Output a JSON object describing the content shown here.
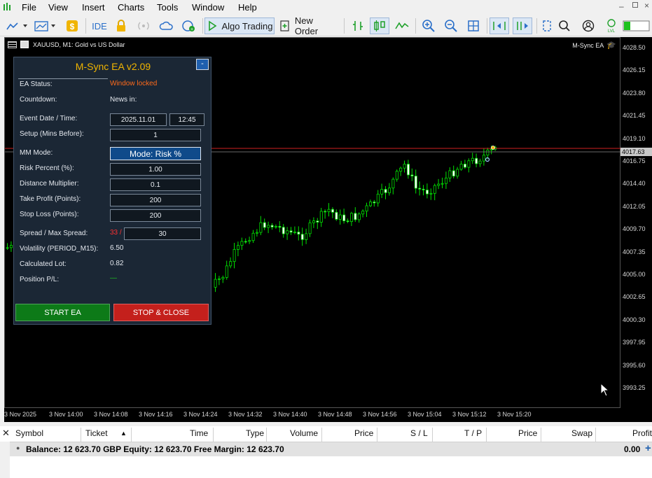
{
  "menu": {
    "items": [
      "File",
      "View",
      "Insert",
      "Charts",
      "Tools",
      "Window",
      "Help"
    ]
  },
  "toolbar": {
    "ide_label": "IDE",
    "algo_trading_label": "Algo Trading",
    "new_order_label": "New Order"
  },
  "chart": {
    "symbol_label": "XAUUSD, M1:  Gold vs US Dollar",
    "ea_label": "M-Sync EA",
    "current_price": "4017.63",
    "price_ticks": [
      "4028.50",
      "4026.15",
      "4023.80",
      "4021.45",
      "4019.10",
      "4016.75",
      "4014.40",
      "4012.05",
      "4009.70",
      "4007.35",
      "4005.00",
      "4002.65",
      "4000.30",
      "3997.95",
      "3995.60",
      "3993.25"
    ],
    "time_ticks": [
      "3 Nov 2025",
      "3 Nov 14:00",
      "3 Nov 14:08",
      "3 Nov 14:16",
      "3 Nov 14:24",
      "3 Nov 14:32",
      "3 Nov 14:40",
      "3 Nov 14:48",
      "3 Nov 14:56",
      "3 Nov 15:04",
      "3 Nov 15:12",
      "3 Nov 15:20"
    ],
    "colors": {
      "bull": "#00e000",
      "bear": "#ffffff",
      "bid_line": "#d02020",
      "background": "#000000"
    }
  },
  "panel": {
    "title": "M-Sync EA v2.09",
    "minimize": "-",
    "ea_status_label": "EA Status:",
    "ea_status_value": "Window locked",
    "countdown_label": "Countdown:",
    "countdown_value": "News in:",
    "event_label": "Event Date / Time:",
    "event_date": "2025.11.01",
    "event_time": "12:45",
    "setup_label": "Setup (Mins Before):",
    "setup_value": "1",
    "mm_label": "MM Mode:",
    "mm_value": "Mode: Risk %",
    "risk_label": "Risk Percent (%):",
    "risk_value": "1.00",
    "distance_label": "Distance Multiplier:",
    "distance_value": "0.1",
    "tp_label": "Take Profit (Points):",
    "tp_value": "200",
    "sl_label": "Stop Loss (Points):",
    "sl_value": "200",
    "spread_label": "Spread / Max Spread:",
    "spread_current": "33 /",
    "spread_max": "30",
    "volatility_label": "Volatility (PERIOD_M15):",
    "volatility_value": "6.50",
    "lot_label": "Calculated Lot:",
    "lot_value": "0.82",
    "pl_label": "Position P/L:",
    "pl_value": "—",
    "start_label": "START EA",
    "stop_label": "STOP & CLOSE",
    "colors": {
      "title": "#f0b400",
      "status": "#ff6a1a",
      "spread": "#ff3030",
      "start_bg": "#0d7a18",
      "stop_bg": "#c4201c",
      "mm_bg": "#0f4a8a"
    }
  },
  "toolbox": {
    "columns": [
      "Symbol",
      "Ticket",
      "Time",
      "Type",
      "Volume",
      "Price",
      "S / L",
      "T / P",
      "Price",
      "Swap",
      "Profit"
    ],
    "balance_text": "Balance: 12 623.70 GBP  Equity: 12 623.70  Free Margin: 12 623.70",
    "profit_total": "0.00"
  }
}
